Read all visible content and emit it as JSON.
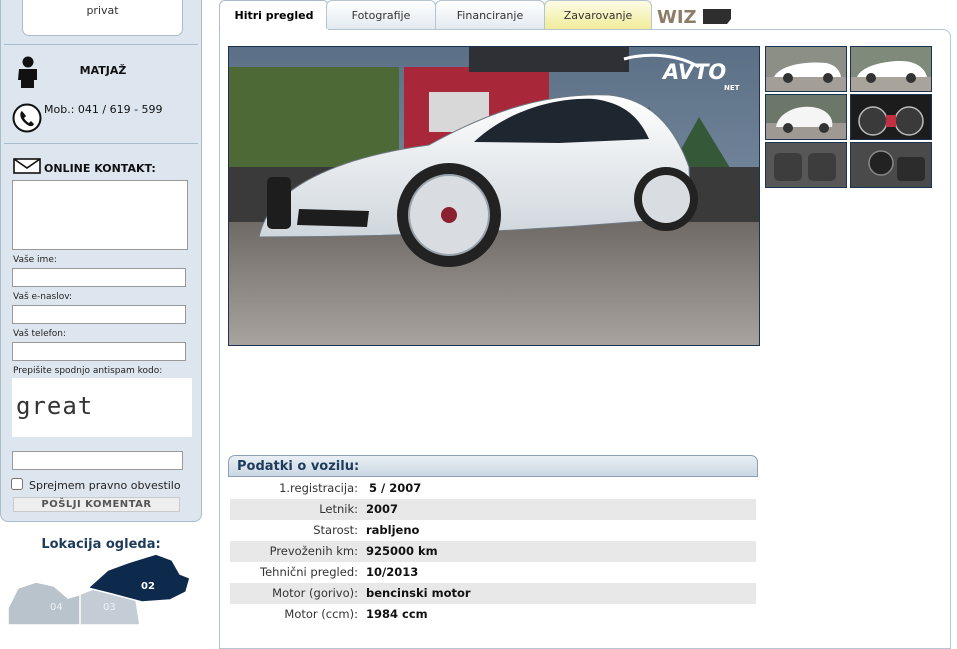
{
  "seller": {
    "type": "privat",
    "name": "MATJAŽ",
    "phone": "Mob.: 041 / 619 - 599"
  },
  "contact": {
    "title": "ONLINE KONTAKT:",
    "name_label": "Vaše ime:",
    "email_label": "Vaš e-naslov:",
    "phone_label": "Vaš telefon:",
    "captcha_label": "Prepišite spodnjo antispam kodo:",
    "captcha_text": "great",
    "terms_label": "Sprejmem pravno obvestilo",
    "submit_label": "POŠLJI KOMENTAR"
  },
  "location": {
    "title": "Lokacija ogleda:",
    "regions": [
      "02",
      "03",
      "04"
    ],
    "active_region": "02"
  },
  "tabs": [
    {
      "label": "Hitri pregled",
      "active": true
    },
    {
      "label": "Fotografije"
    },
    {
      "label": "Financiranje"
    },
    {
      "label": "Zavarovanje"
    }
  ],
  "wiz_logo": "WIZ",
  "photo_watermark": {
    "brand": "AVTO",
    "sub": "NET"
  },
  "vehicle": {
    "title": "Podatki o vozilu:",
    "rows": [
      {
        "key": "1.registracija:",
        "value": "5 / 2007"
      },
      {
        "key": "Letnik:",
        "value": "2007"
      },
      {
        "key": "Starost:",
        "value": "rabljeno"
      },
      {
        "key": "Prevoženih km:",
        "value": "925000 km"
      },
      {
        "key": "Tehnični pregled:",
        "value": "10/2013"
      },
      {
        "key": "Motor (gorivo):",
        "value": "bencinski motor"
      },
      {
        "key": "Motor (ccm):",
        "value": "1984 ccm"
      }
    ]
  },
  "colors": {
    "sidebar_bg": "#dde6ee",
    "border": "#a9bccb",
    "navy": "#1f3b5c",
    "map_active": "#0d2a4d",
    "map_inactive": "#b8c3cc"
  }
}
